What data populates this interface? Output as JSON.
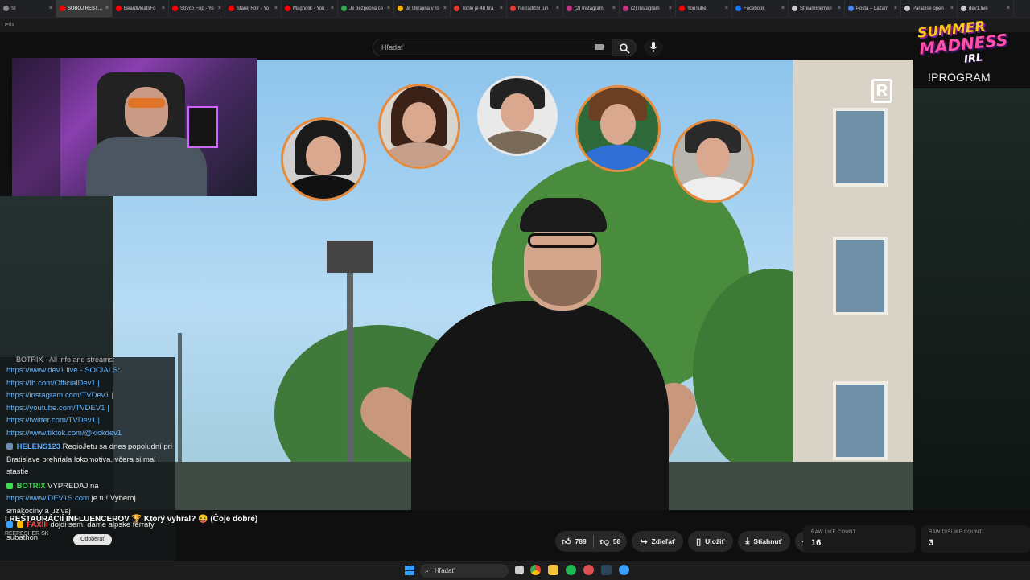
{
  "browser": {
    "tabs": [
      {
        "label": "SI",
        "color": "#888888",
        "active": false
      },
      {
        "label": "SÚBOJ REŠTAU",
        "color": "#ff0000",
        "active": true
      },
      {
        "label": "BeardMeatsFo",
        "color": "#ff0000",
        "active": false
      },
      {
        "label": "Strýco Filip - Yo",
        "color": "#ff0000",
        "active": false
      },
      {
        "label": "Starej Fotr - Yo",
        "color": "#ff0000",
        "active": false
      },
      {
        "label": "Magnolik - You",
        "color": "#ff0000",
        "active": false
      },
      {
        "label": "Je bezpecna ce",
        "color": "#34a853",
        "active": false
      },
      {
        "label": "Je Ukrajina v ro",
        "color": "#f4b400",
        "active": false
      },
      {
        "label": "Tohle je 48 hrá",
        "color": "#e53935",
        "active": false
      },
      {
        "label": "Netradiční turi",
        "color": "#e53935",
        "active": false
      },
      {
        "label": "(2) Instagram",
        "color": "#c13584",
        "active": false
      },
      {
        "label": "(2) Instagram",
        "color": "#c13584",
        "active": false
      },
      {
        "label": "YouTube",
        "color": "#ff0000",
        "active": false
      },
      {
        "label": "Facebook",
        "color": "#1877f2",
        "active": false
      },
      {
        "label": "StreamElemen",
        "color": "#cccccc",
        "active": false
      },
      {
        "label": "Pošta – Lazarn",
        "color": "#4285f4",
        "active": false
      },
      {
        "label": "Paradise open",
        "color": "#cccccc",
        "active": false
      },
      {
        "label": "dev1.live",
        "color": "#cccccc",
        "active": false
      }
    ],
    "close_glyph": "×",
    "address_text": "t=8s"
  },
  "youtube": {
    "search_placeholder": "Hľadať",
    "logo_text": "R"
  },
  "overlay": {
    "logo_line1": "SUMMER",
    "logo_line2": "MADNESS",
    "logo_line3": "IRL",
    "program": "!PROGRAM"
  },
  "chat": {
    "cut_line": "BOTRIX · All info and streams:",
    "links": [
      "https://www.dev1.live - SOCIALS:",
      "https://fb.com/OfficialDev1 |",
      "https://instagram.com/TVDev1 |",
      "https://youtube.com/TVDEV1 |",
      "https://twitter.com/TVDev1 |",
      "https://www.tiktok.com/@kickdev1"
    ],
    "messages": [
      {
        "user": "HELENS123",
        "user_color": "#5aa9ff",
        "text": "RegioJetu sa dnes popoludní pri Bratislave prehriala lokomotiva. včera si mal stastie"
      },
      {
        "user": "BOTRIX",
        "user_color": "#3ddc4a",
        "text": "VYPREDAJ na",
        "link": "https://www.DEV1S.com",
        "text2": "je tu! Vyberoj smakociny a uzivaj"
      },
      {
        "user": "FAXIII",
        "user_color": "#ff4d4d",
        "text": "dojdi sem, dame alpske ferraty subathon"
      }
    ]
  },
  "video": {
    "title_prefix": "I REŠTAURÁCIÍ INFLUENCEROV",
    "title_trophy": "🏆",
    "title_suffix": "Ktorý vyhral?",
    "title_emoji": "😝",
    "title_end": "(Čoje dobré)",
    "refresher": "REFRESHER SK",
    "subscribe": "Odoberať"
  },
  "actions": {
    "likes": "789",
    "dislikes": "58",
    "share": "Zdieľať",
    "save": "Uložiť",
    "download": "Stiahnuť",
    "more": "···"
  },
  "stats": {
    "raw_like_label": "RAW LIKE COUNT",
    "raw_like_value": "16",
    "raw_dislike_label": "RAW DISLIKE COUNT",
    "raw_dislike_value": "3"
  },
  "taskbar": {
    "search": "Hľadať"
  }
}
